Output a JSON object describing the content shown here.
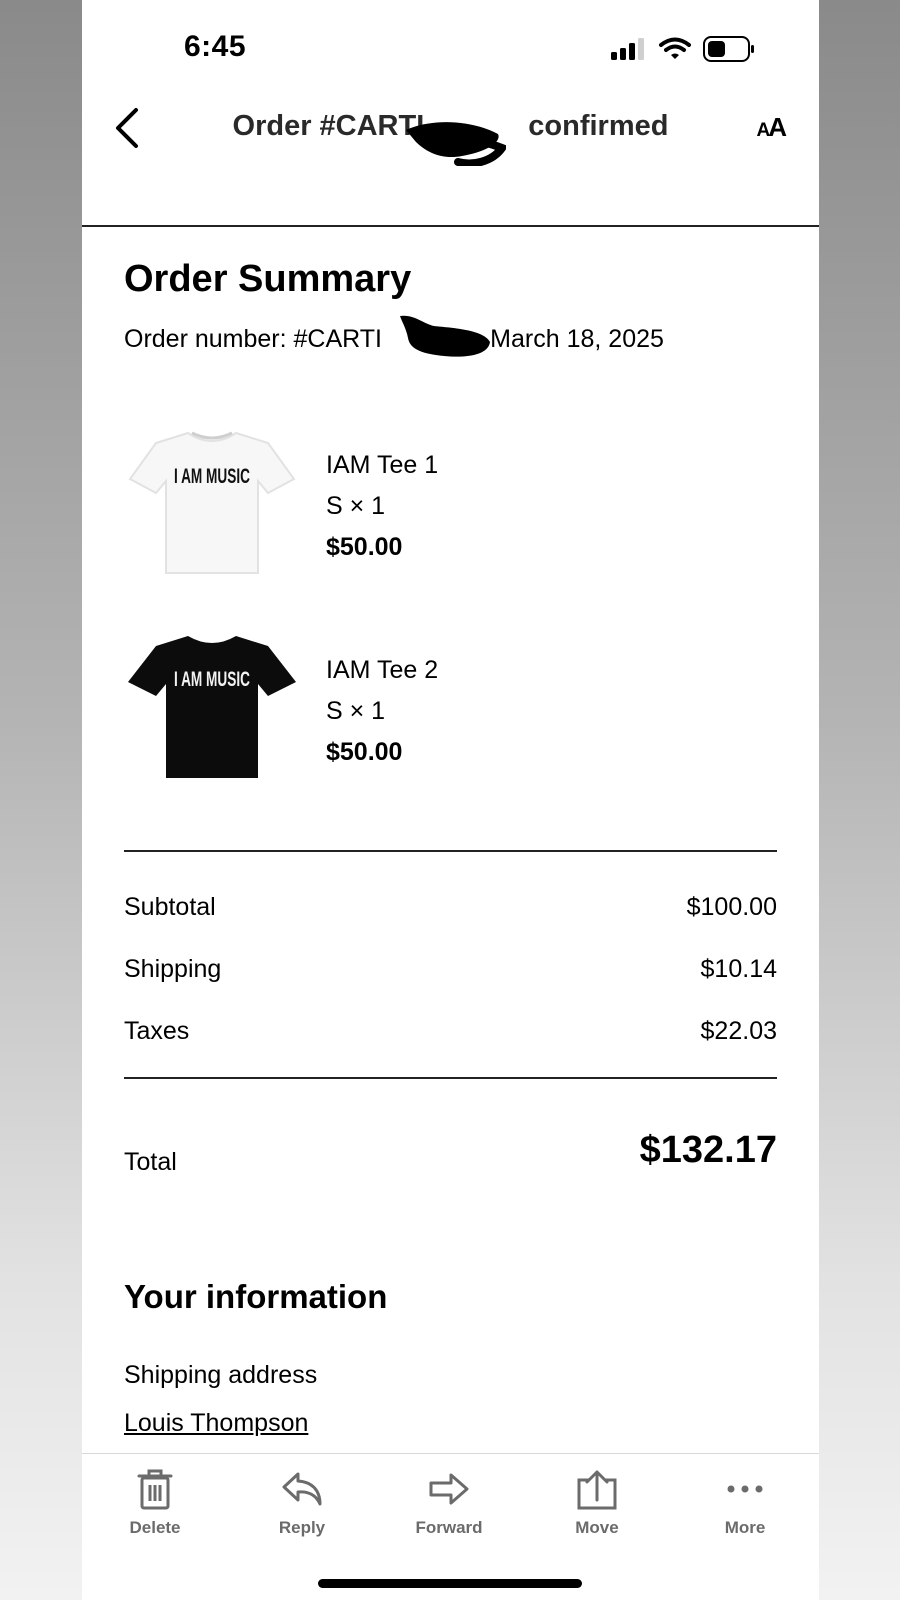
{
  "status_bar": {
    "time": "6:45"
  },
  "header": {
    "title_prefix": "Order #CARTI",
    "title_suffix": "confirmed",
    "text_size_label_small": "A",
    "text_size_label_large": "A"
  },
  "summary": {
    "heading": "Order Summary",
    "order_prefix": "Order number: #CARTI",
    "order_suffix": " - March 18, 2025"
  },
  "items": [
    {
      "name": "IAM Tee 1",
      "variant": "S × 1",
      "price": "$50.00",
      "print_text": "I AM MUSIC",
      "shirt_color": "#f7f7f7",
      "print_color": "#111111"
    },
    {
      "name": "IAM Tee 2",
      "variant": "S × 1",
      "price": "$50.00",
      "print_text": "I AM MUSIC",
      "shirt_color": "#0c0c0c",
      "print_color": "#f2f2f2"
    }
  ],
  "totals": {
    "subtotal_label": "Subtotal",
    "subtotal": "$100.00",
    "shipping_label": "Shipping",
    "shipping": "$10.14",
    "taxes_label": "Taxes",
    "taxes": "$22.03",
    "total_label": "Total",
    "total": "$132.17"
  },
  "info": {
    "heading": "Your information",
    "shipping_address_label": "Shipping address",
    "name": "Louis Thompson"
  },
  "toolbar": {
    "delete": "Delete",
    "reply": "Reply",
    "forward": "Forward",
    "move": "Move",
    "more": "More"
  },
  "icons": {
    "back": "chevron-left-icon",
    "text_size": "text-size-icon",
    "delete": "trash-icon",
    "reply": "reply-icon",
    "forward": "forward-icon",
    "move": "move-to-folder-icon",
    "more": "ellipsis-icon"
  }
}
